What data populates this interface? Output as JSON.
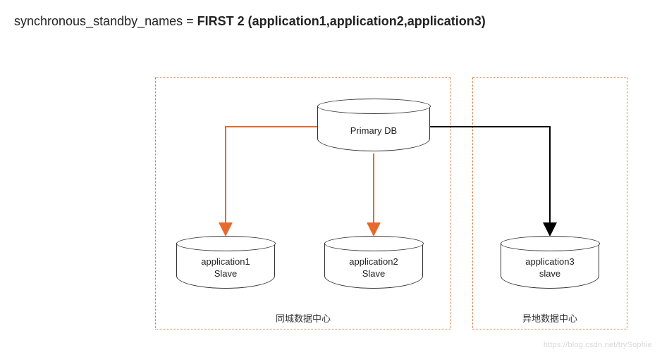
{
  "heading": {
    "param": "synchronous_standby_names = ",
    "value": "FIRST 2 (application1,application2,application3)"
  },
  "diagram": {
    "primary_db": "Primary DB",
    "slaves": {
      "app1_line1": "application1",
      "app1_line2": "Slave",
      "app2_line1": "application2",
      "app2_line2": "Slave",
      "app3_line1": "application3",
      "app3_line2": "slave"
    },
    "regions": {
      "local": "同城数据中心",
      "remote": "异地数据中心"
    },
    "connections": [
      {
        "from": "primary_db",
        "to": "application1",
        "color": "#e66a2c",
        "sync": true
      },
      {
        "from": "primary_db",
        "to": "application2",
        "color": "#e66a2c",
        "sync": true
      },
      {
        "from": "primary_db",
        "to": "application3",
        "color": "#000000",
        "sync": false
      }
    ]
  },
  "watermark": "https://blog.csdn.net/trySophie"
}
